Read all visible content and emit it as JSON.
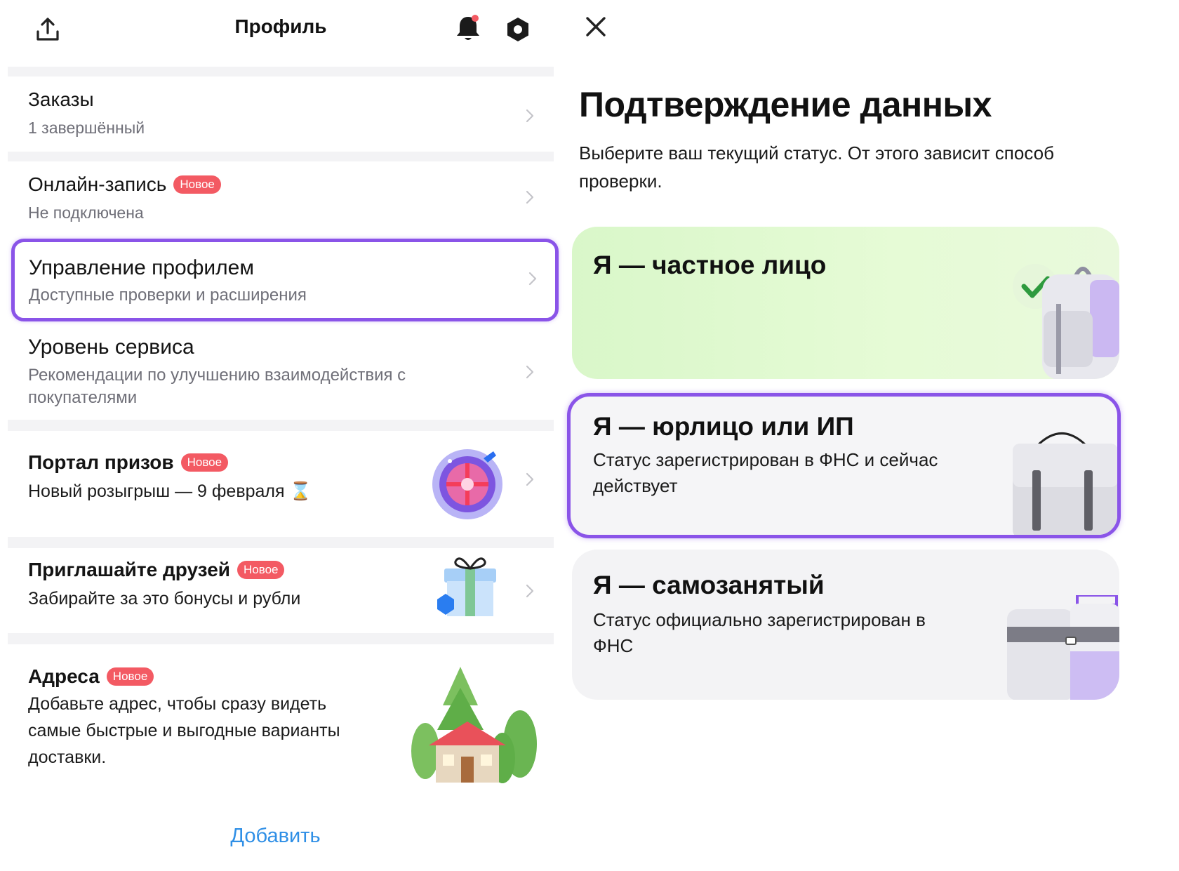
{
  "left": {
    "header": {
      "title": "Профиль"
    },
    "items": [
      {
        "title": "Заказы",
        "subtitle": "1 завершённый"
      },
      {
        "title": "Онлайн-запись",
        "badge": "Новое",
        "subtitle": "Не подключена"
      },
      {
        "title": "Управление профилем",
        "subtitle": "Доступные проверки и расширения"
      },
      {
        "title": "Уровень сервиса",
        "subtitle": "Рекомендации по улучшению взаимодействия с покупателями"
      },
      {
        "title": "Портал призов",
        "badge": "Новое",
        "subtitle": "Новый розыгрыш — 9 февраля ⌛"
      },
      {
        "title": "Приглашайте друзей",
        "badge": "Новое",
        "subtitle": "Забирайте за это бонусы и рубли"
      },
      {
        "title": "Адреса",
        "badge": "Новое",
        "subtitle": "Добавьте адрес, чтобы сразу видеть самые быстрые и выгодные варианты доставки."
      }
    ],
    "add_link": "Добавить"
  },
  "right": {
    "title": "Подтверждение данных",
    "description": "Выберите ваш текущий статус. От этого зависит способ проверки.",
    "options": [
      {
        "title": "Я — частное лицо",
        "subtitle": "",
        "selected_check": true
      },
      {
        "title": "Я — юрлицо или ИП",
        "subtitle": "Статус зарегистрирован в ФНС и сейчас действует",
        "highlighted": true
      },
      {
        "title": "Я — самозанятый",
        "subtitle": "Статус официально зарегистрирован в ФНС"
      }
    ]
  },
  "colors": {
    "accent": "#8a54e8",
    "badge": "#f35a63",
    "link": "#2f8fe6",
    "check": "#2e9a3e"
  },
  "icons": [
    "share-icon",
    "bell-icon",
    "settings-icon",
    "chevron-right-icon",
    "close-icon",
    "checkmark-icon"
  ]
}
